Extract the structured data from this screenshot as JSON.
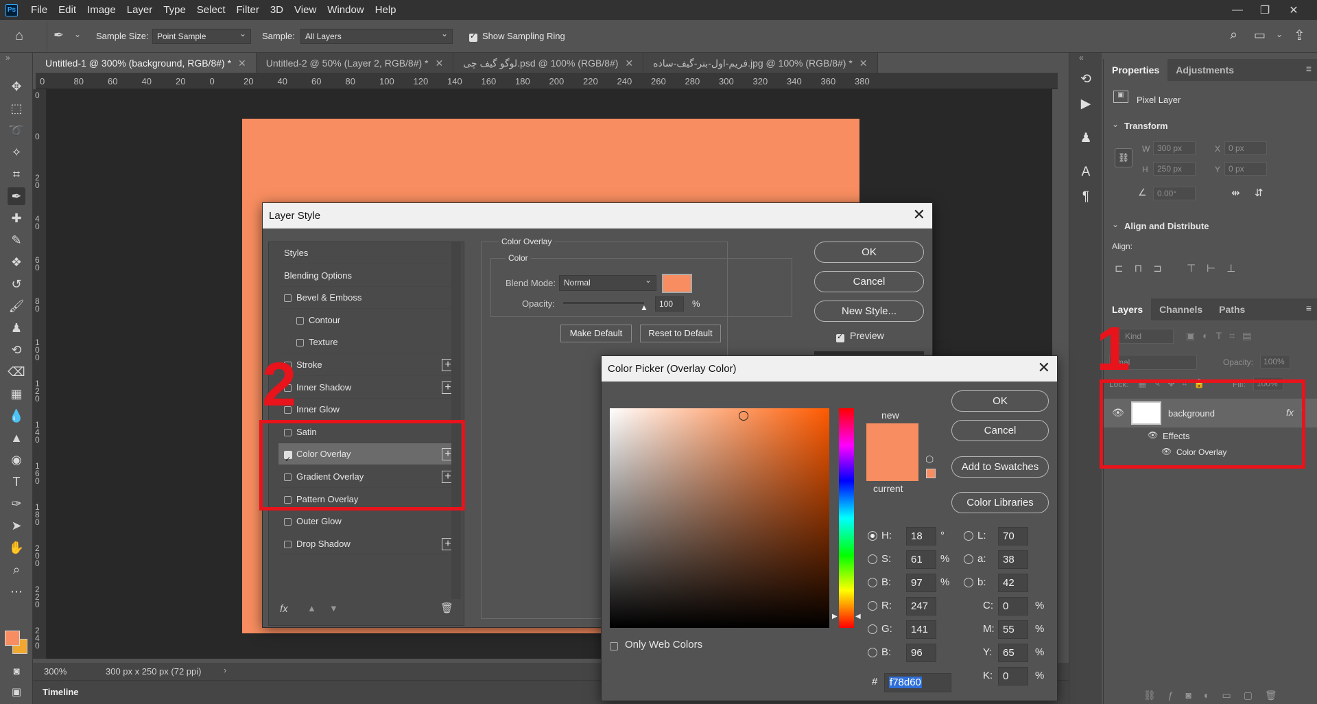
{
  "app": {
    "logo": "Ps",
    "menu": [
      "File",
      "Edit",
      "Image",
      "Layer",
      "Type",
      "Select",
      "Filter",
      "3D",
      "View",
      "Window",
      "Help"
    ]
  },
  "options": {
    "sample_size_label": "Sample Size:",
    "sample_size_value": "Point Sample",
    "sample_label": "Sample:",
    "sample_value": "All Layers",
    "show_ring_label": "Show Sampling Ring"
  },
  "tabs": [
    "Untitled-1 @ 300% (background, RGB/8#) *",
    "Untitled-2 @ 50% (Layer 2, RGB/8#) *",
    "لوگو گیف چی.psd @ 100% (RGB/8#)",
    "فریم-اول-بنر-گیف-ساده.jpg @ 100% (RGB/8#) *"
  ],
  "ruler_h": [
    "0",
    "80",
    "60",
    "40",
    "20",
    "0",
    "20",
    "40",
    "60",
    "80",
    "100",
    "120",
    "140",
    "160",
    "180",
    "200",
    "220",
    "240",
    "260",
    "280",
    "300",
    "320",
    "340",
    "360",
    "380"
  ],
  "ruler_v": [
    "0",
    "0",
    "20",
    "40",
    "60",
    "80",
    "100",
    "120",
    "140",
    "160",
    "180",
    "200",
    "220",
    "240"
  ],
  "status": {
    "zoom": "300%",
    "doc": "300 px x 250 px (72 ppi)"
  },
  "timeline": "Timeline",
  "properties": {
    "tabs": [
      "Properties",
      "Adjustments"
    ],
    "pixel_layer": "Pixel Layer",
    "transform": "Transform",
    "w_label": "W",
    "w": "300 px",
    "h_label": "H",
    "h": "250 px",
    "x_label": "X",
    "x": "0 px",
    "y_label": "Y",
    "y": "0 px",
    "angle": "0.00°",
    "align_distribute": "Align and Distribute",
    "align": "Align:"
  },
  "layers": {
    "tabs": [
      "Layers",
      "Channels",
      "Paths"
    ],
    "kind": "Kind",
    "blend": "rmal",
    "opacity_label": "Opacity:",
    "opacity": "100%",
    "lock": "Lock:",
    "fill_label": "Fill:",
    "fill": "100%",
    "layer_name": "background",
    "fx": "fx",
    "effects": "Effects",
    "effect_item": "Color Overlay"
  },
  "layer_style": {
    "title": "Layer Style",
    "items": [
      {
        "label": "Styles",
        "check": false,
        "plus": false,
        "indent": false,
        "header": true
      },
      {
        "label": "Blending Options",
        "check": false,
        "plus": false,
        "indent": false,
        "header": true
      },
      {
        "label": "Bevel & Emboss",
        "check": true,
        "plus": false,
        "indent": false
      },
      {
        "label": "Contour",
        "check": true,
        "plus": false,
        "indent": true
      },
      {
        "label": "Texture",
        "check": true,
        "plus": false,
        "indent": true
      },
      {
        "label": "Stroke",
        "check": true,
        "plus": true,
        "indent": false
      },
      {
        "label": "Inner Shadow",
        "check": true,
        "plus": true,
        "indent": false
      },
      {
        "label": "Inner Glow",
        "check": true,
        "plus": false,
        "indent": false
      },
      {
        "label": "Satin",
        "check": true,
        "plus": false,
        "indent": false
      },
      {
        "label": "Color Overlay",
        "check": true,
        "plus": true,
        "indent": false,
        "checked": true,
        "selected": true
      },
      {
        "label": "Gradient Overlay",
        "check": true,
        "plus": true,
        "indent": false
      },
      {
        "label": "Pattern Overlay",
        "check": true,
        "plus": false,
        "indent": false
      },
      {
        "label": "Outer Glow",
        "check": true,
        "plus": false,
        "indent": false
      },
      {
        "label": "Drop Shadow",
        "check": true,
        "plus": true,
        "indent": false
      }
    ],
    "group_title": "Color Overlay",
    "sub_title": "Color",
    "blend_label": "Blend Mode:",
    "blend_value": "Normal",
    "opacity_label": "Opacity:",
    "opacity_value": "100",
    "opacity_unit": "%",
    "opacity_fraction": 1.0,
    "make_default": "Make Default",
    "reset_default": "Reset to Default",
    "ok": "OK",
    "cancel": "Cancel",
    "new_style": "New Style...",
    "preview": "Preview",
    "overlay_color": "#f78d60"
  },
  "color_picker": {
    "title": "Color Picker (Overlay Color)",
    "new_label": "new",
    "current_label": "current",
    "ok": "OK",
    "cancel": "Cancel",
    "add_swatches": "Add to Swatches",
    "libraries": "Color Libraries",
    "only_web": "Only Web Colors",
    "hsb": [
      {
        "label": "H:",
        "value": "18",
        "unit": "°"
      },
      {
        "label": "S:",
        "value": "61",
        "unit": "%"
      },
      {
        "label": "B:",
        "value": "97",
        "unit": "%"
      }
    ],
    "rgb": [
      {
        "label": "R:",
        "value": "247"
      },
      {
        "label": "G:",
        "value": "141"
      },
      {
        "label": "B:",
        "value": "96"
      }
    ],
    "lab": [
      {
        "label": "L:",
        "value": "70"
      },
      {
        "label": "a:",
        "value": "38"
      },
      {
        "label": "b:",
        "value": "42"
      }
    ],
    "cmyk": [
      {
        "label": "C:",
        "value": "0",
        "unit": "%"
      },
      {
        "label": "M:",
        "value": "55",
        "unit": "%"
      },
      {
        "label": "Y:",
        "value": "65",
        "unit": "%"
      },
      {
        "label": "K:",
        "value": "0",
        "unit": "%"
      }
    ],
    "hash": "#",
    "hex": "f78d60",
    "color": "#f78d60",
    "hue_color": "#ff5a00"
  },
  "annotations": {
    "one": "1",
    "two": "2"
  }
}
